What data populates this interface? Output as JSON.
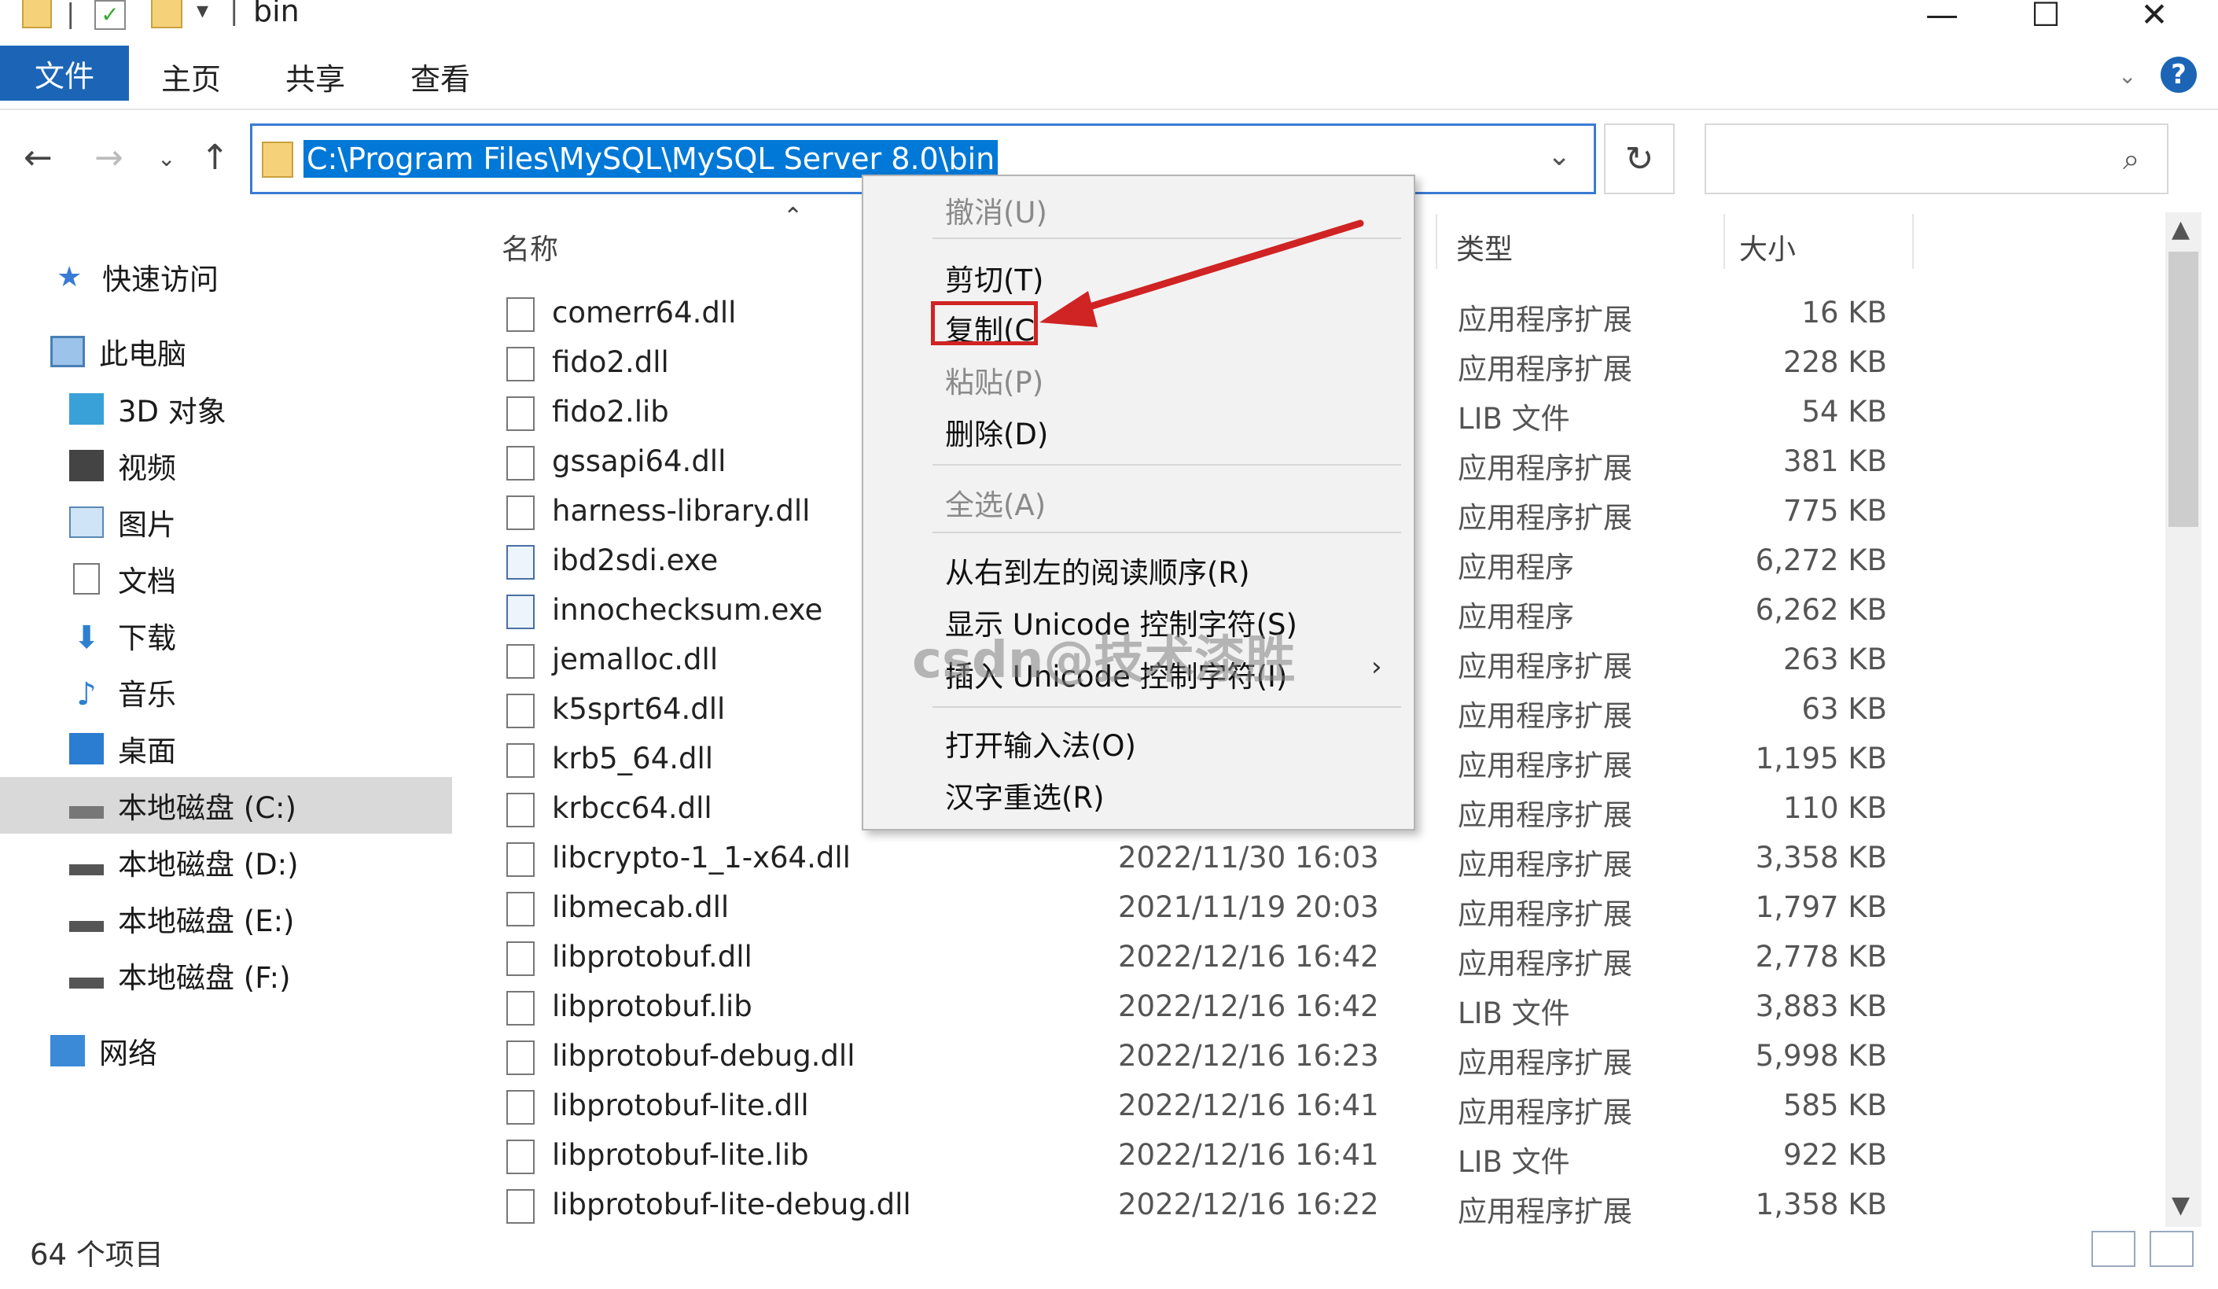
{
  "window": {
    "title": "bin",
    "minimize": "—",
    "maximize": "☐",
    "close": "✕"
  },
  "ribbon": {
    "file_tab": "文件",
    "tabs": [
      "主页",
      "共享",
      "查看"
    ],
    "help": "?"
  },
  "address": {
    "path": "C:\\Program Files\\MySQL\\MySQL Server 8.0\\bin",
    "search_placeholder": ""
  },
  "nav": {
    "quick_access": "快速访问",
    "this_pc": "此电脑",
    "items": [
      "3D 对象",
      "视频",
      "图片",
      "文档",
      "下载",
      "音乐",
      "桌面",
      "本地磁盘 (C:)",
      "本地磁盘 (D:)",
      "本地磁盘 (E:)",
      "本地磁盘 (F:)"
    ],
    "network": "网络",
    "selected": "本地磁盘 (C:)"
  },
  "columns": {
    "name": "名称",
    "type": "类型",
    "size": "大小"
  },
  "files": [
    {
      "name": "comerr64.dll",
      "date": "",
      "type": "应用程序扩展",
      "size": "16 KB",
      "icon": "dll"
    },
    {
      "name": "fido2.dll",
      "date": "",
      "type": "应用程序扩展",
      "size": "228 KB",
      "icon": "dll"
    },
    {
      "name": "fido2.lib",
      "date": "",
      "type": "LIB 文件",
      "size": "54 KB",
      "icon": "file"
    },
    {
      "name": "gssapi64.dll",
      "date": "",
      "type": "应用程序扩展",
      "size": "381 KB",
      "icon": "dll"
    },
    {
      "name": "harness-library.dll",
      "date": "",
      "type": "应用程序扩展",
      "size": "775 KB",
      "icon": "dll"
    },
    {
      "name": "ibd2sdi.exe",
      "date": "",
      "type": "应用程序",
      "size": "6,272 KB",
      "icon": "exe"
    },
    {
      "name": "innochecksum.exe",
      "date": "",
      "type": "应用程序",
      "size": "6,262 KB",
      "icon": "exe"
    },
    {
      "name": "jemalloc.dll",
      "date": "",
      "type": "应用程序扩展",
      "size": "263 KB",
      "icon": "dll"
    },
    {
      "name": "k5sprt64.dll",
      "date": "",
      "type": "应用程序扩展",
      "size": "63 KB",
      "icon": "dll"
    },
    {
      "name": "krb5_64.dll",
      "date": "",
      "type": "应用程序扩展",
      "size": "1,195 KB",
      "icon": "dll"
    },
    {
      "name": "krbcc64.dll",
      "date": "",
      "type": "应用程序扩展",
      "size": "110 KB",
      "icon": "dll"
    },
    {
      "name": "libcrypto-1_1-x64.dll",
      "date": "2022/11/30 16:03",
      "type": "应用程序扩展",
      "size": "3,358 KB",
      "icon": "dll"
    },
    {
      "name": "libmecab.dll",
      "date": "2021/11/19 20:03",
      "type": "应用程序扩展",
      "size": "1,797 KB",
      "icon": "dll"
    },
    {
      "name": "libprotobuf.dll",
      "date": "2022/12/16 16:42",
      "type": "应用程序扩展",
      "size": "2,778 KB",
      "icon": "dll"
    },
    {
      "name": "libprotobuf.lib",
      "date": "2022/12/16 16:42",
      "type": "LIB 文件",
      "size": "3,883 KB",
      "icon": "file"
    },
    {
      "name": "libprotobuf-debug.dll",
      "date": "2022/12/16 16:23",
      "type": "应用程序扩展",
      "size": "5,998 KB",
      "icon": "dll"
    },
    {
      "name": "libprotobuf-lite.dll",
      "date": "2022/12/16 16:41",
      "type": "应用程序扩展",
      "size": "585 KB",
      "icon": "dll"
    },
    {
      "name": "libprotobuf-lite.lib",
      "date": "2022/12/16 16:41",
      "type": "LIB 文件",
      "size": "922 KB",
      "icon": "file"
    },
    {
      "name": "libprotobuf-lite-debug.dll",
      "date": "2022/12/16 16:22",
      "type": "应用程序扩展",
      "size": "1,358 KB",
      "icon": "dll"
    }
  ],
  "context_menu": {
    "undo": "撤消(U)",
    "cut": "剪切(T)",
    "copy": "复制(C",
    "paste": "粘贴(P)",
    "delete": "删除(D)",
    "select_all": "全选(A)",
    "rtl": "从右到左的阅读顺序(R)",
    "show_unicode": "显示 Unicode 控制字符(S)",
    "insert_unicode": "插入 Unicode 控制字符(I)",
    "open_ime": "打开输入法(O)",
    "reconvert": "汉字重选(R)"
  },
  "watermark": "csdn@技术漆胜",
  "status": {
    "item_count": "64 个项目"
  },
  "colors": {
    "accent": "#1c65b6",
    "selection": "#0078d7",
    "highlight_box": "#d02323",
    "arrow": "#d02323"
  }
}
